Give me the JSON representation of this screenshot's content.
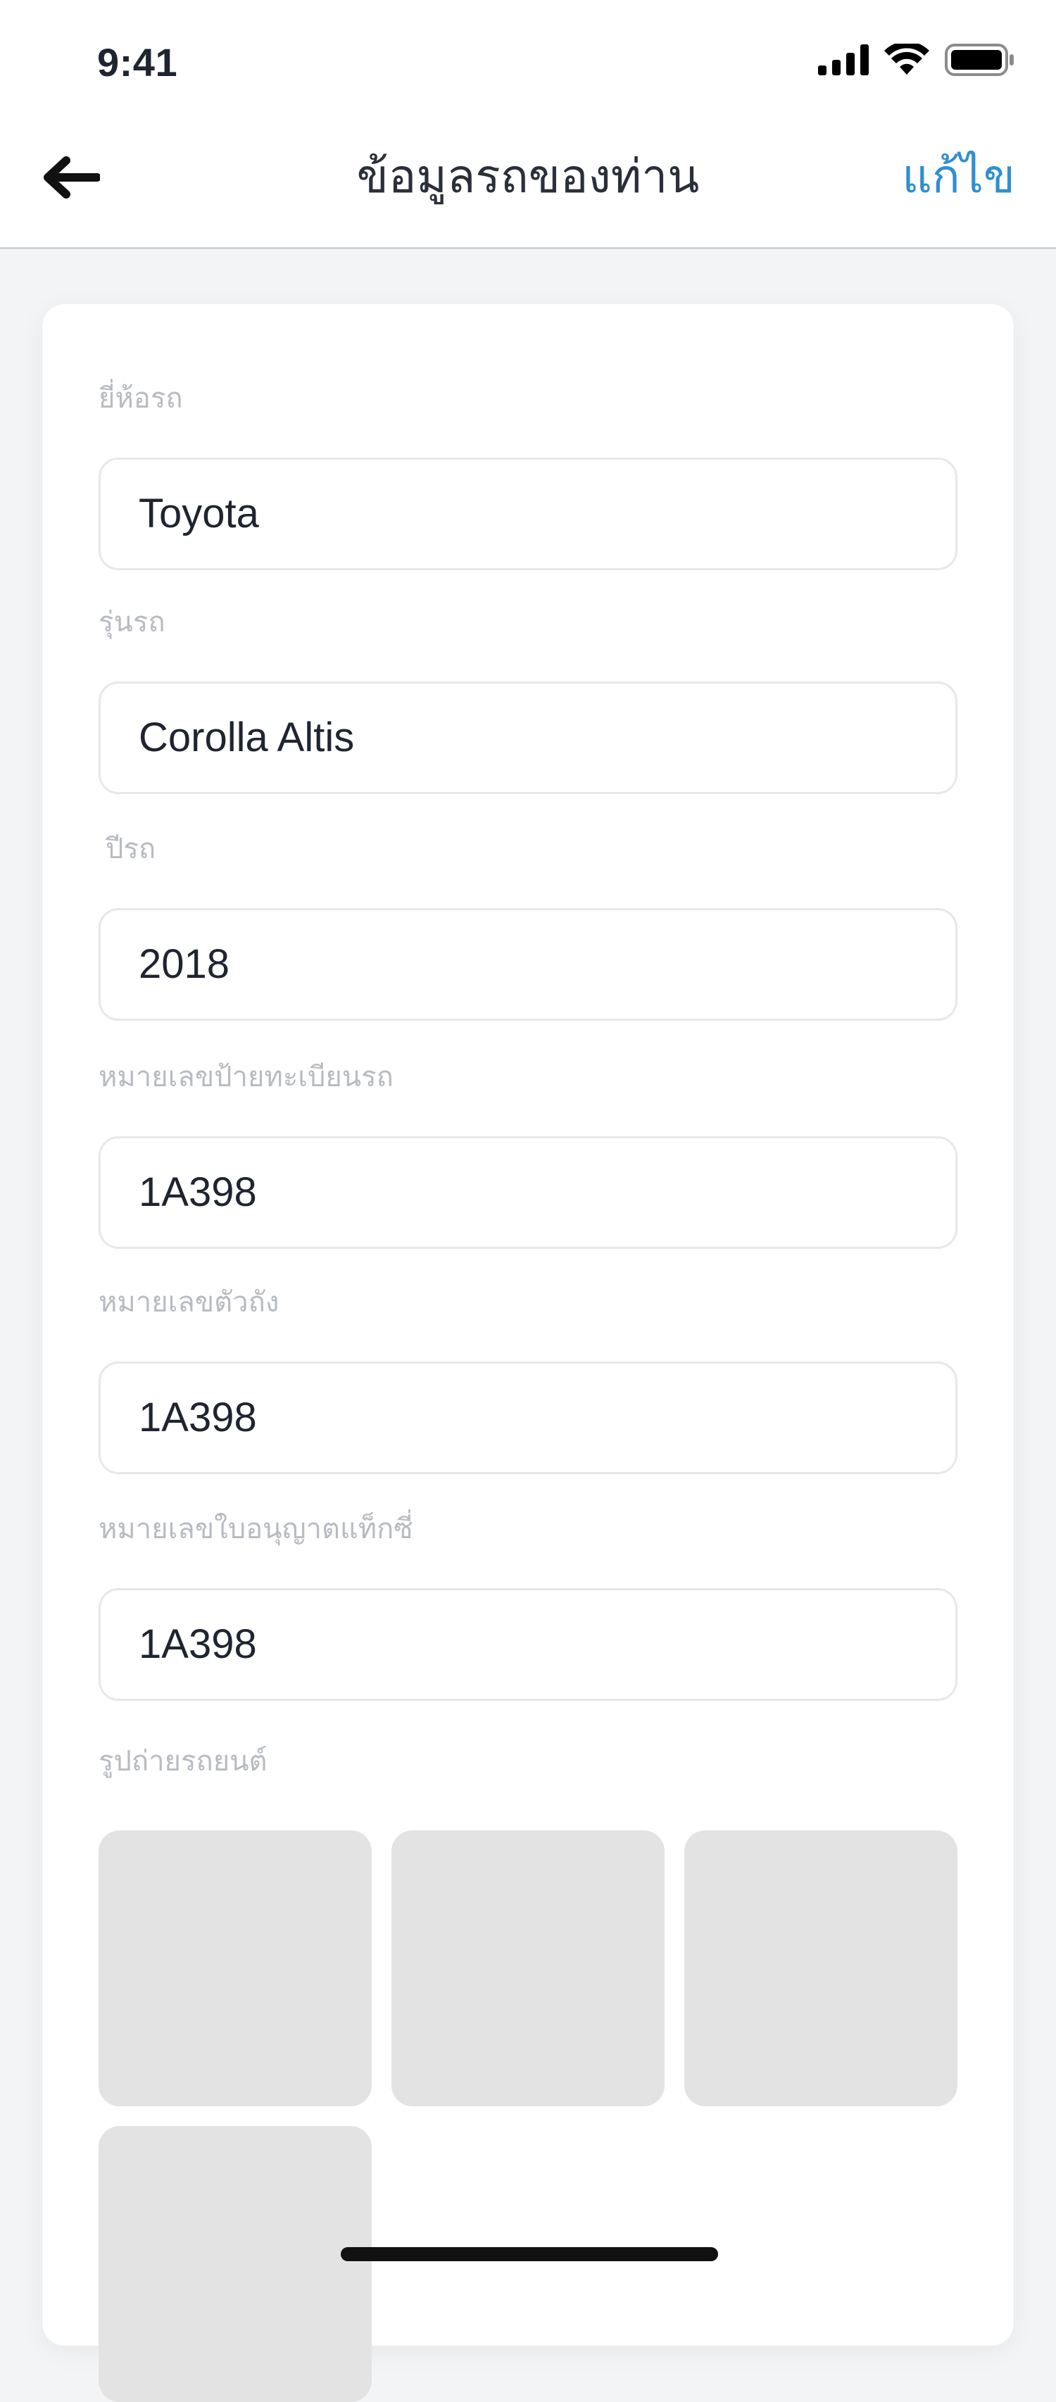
{
  "status_bar": {
    "time": "9:41",
    "icons": [
      "signal-icon",
      "wifi-icon",
      "battery-icon"
    ]
  },
  "header": {
    "back_icon": "arrow-left-icon",
    "title": "ข้อมูลรถของท่าน",
    "edit_label": "แก้ไข"
  },
  "form": {
    "brand": {
      "label": "ยี่ห้อรถ",
      "value": "Toyota"
    },
    "model": {
      "label": "รุ่นรถ",
      "value": "Corolla Altis"
    },
    "year": {
      "label": "ปีรถ",
      "value": "2018"
    },
    "plate": {
      "label": "หมายเลขป้ายทะเบียนรถ",
      "value": "1A398"
    },
    "chassis": {
      "label": "หมายเลขตัวถัง",
      "value": "1A398"
    },
    "taxi_license": {
      "label": "หมายเลขใบอนุญาตแท็กซี่",
      "value": "1A398"
    }
  },
  "photos": {
    "label": "รูปถ่ายรถยนต์",
    "slot_count": 4
  },
  "colors": {
    "accent": "#2f8fd0",
    "label": "#b8bbc2",
    "placeholder_tile": "#e3e3e3",
    "background": "#f3f4f6"
  }
}
